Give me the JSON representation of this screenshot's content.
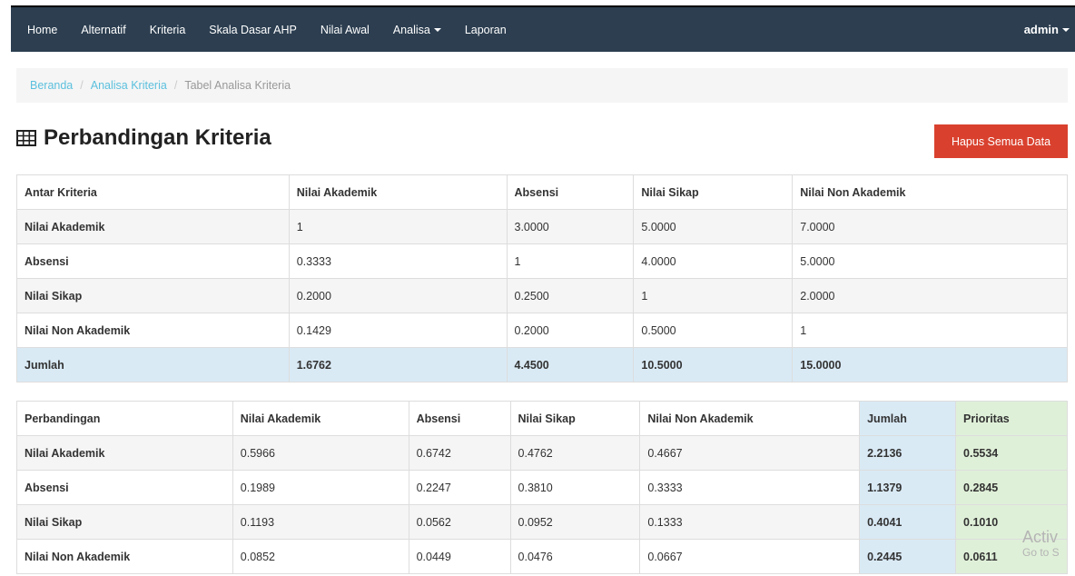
{
  "navbar": {
    "items": [
      "Home",
      "Alternatif",
      "Kriteria",
      "Skala Dasar AHP",
      "Nilai Awal",
      "Analisa",
      "Laporan"
    ],
    "user": "admin"
  },
  "breadcrumb": {
    "home": "Beranda",
    "link": "Analisa Kriteria",
    "active": "Tabel Analisa Kriteria"
  },
  "page": {
    "title": "Perbandingan Kriteria",
    "delete_button": "Hapus Semua Data"
  },
  "table1": {
    "headers": [
      "Antar Kriteria",
      "Nilai Akademik",
      "Absensi",
      "Nilai Sikap",
      "Nilai Non Akademik"
    ],
    "rows": [
      [
        "Nilai Akademik",
        "1",
        "3.0000",
        "5.0000",
        "7.0000"
      ],
      [
        "Absensi",
        "0.3333",
        "1",
        "4.0000",
        "5.0000"
      ],
      [
        "Nilai Sikap",
        "0.2000",
        "0.2500",
        "1",
        "2.0000"
      ],
      [
        "Nilai Non Akademik",
        "0.1429",
        "0.2000",
        "0.5000",
        "1"
      ]
    ],
    "total": [
      "Jumlah",
      "1.6762",
      "4.4500",
      "10.5000",
      "15.0000"
    ]
  },
  "table2": {
    "headers": [
      "Perbandingan",
      "Nilai Akademik",
      "Absensi",
      "Nilai Sikap",
      "Nilai Non Akademik",
      "Jumlah",
      "Prioritas"
    ],
    "rows": [
      [
        "Nilai Akademik",
        "0.5966",
        "0.6742",
        "0.4762",
        "0.4667",
        "2.2136",
        "0.5534"
      ],
      [
        "Absensi",
        "0.1989",
        "0.2247",
        "0.3810",
        "0.3333",
        "1.1379",
        "0.2845"
      ],
      [
        "Nilai Sikap",
        "0.1193",
        "0.0562",
        "0.0952",
        "0.1333",
        "0.4041",
        "0.1010"
      ],
      [
        "Nilai Non Akademik",
        "0.0852",
        "0.0449",
        "0.0476",
        "0.0667",
        "0.2445",
        "0.0611"
      ]
    ]
  },
  "watermark": {
    "line1": "Activ",
    "line2": "Go to S"
  },
  "colors": {
    "navbar": "#2c3e50",
    "danger": "#d9412e",
    "info_row": "#d9eaf5",
    "success_col": "#dff0d8"
  }
}
